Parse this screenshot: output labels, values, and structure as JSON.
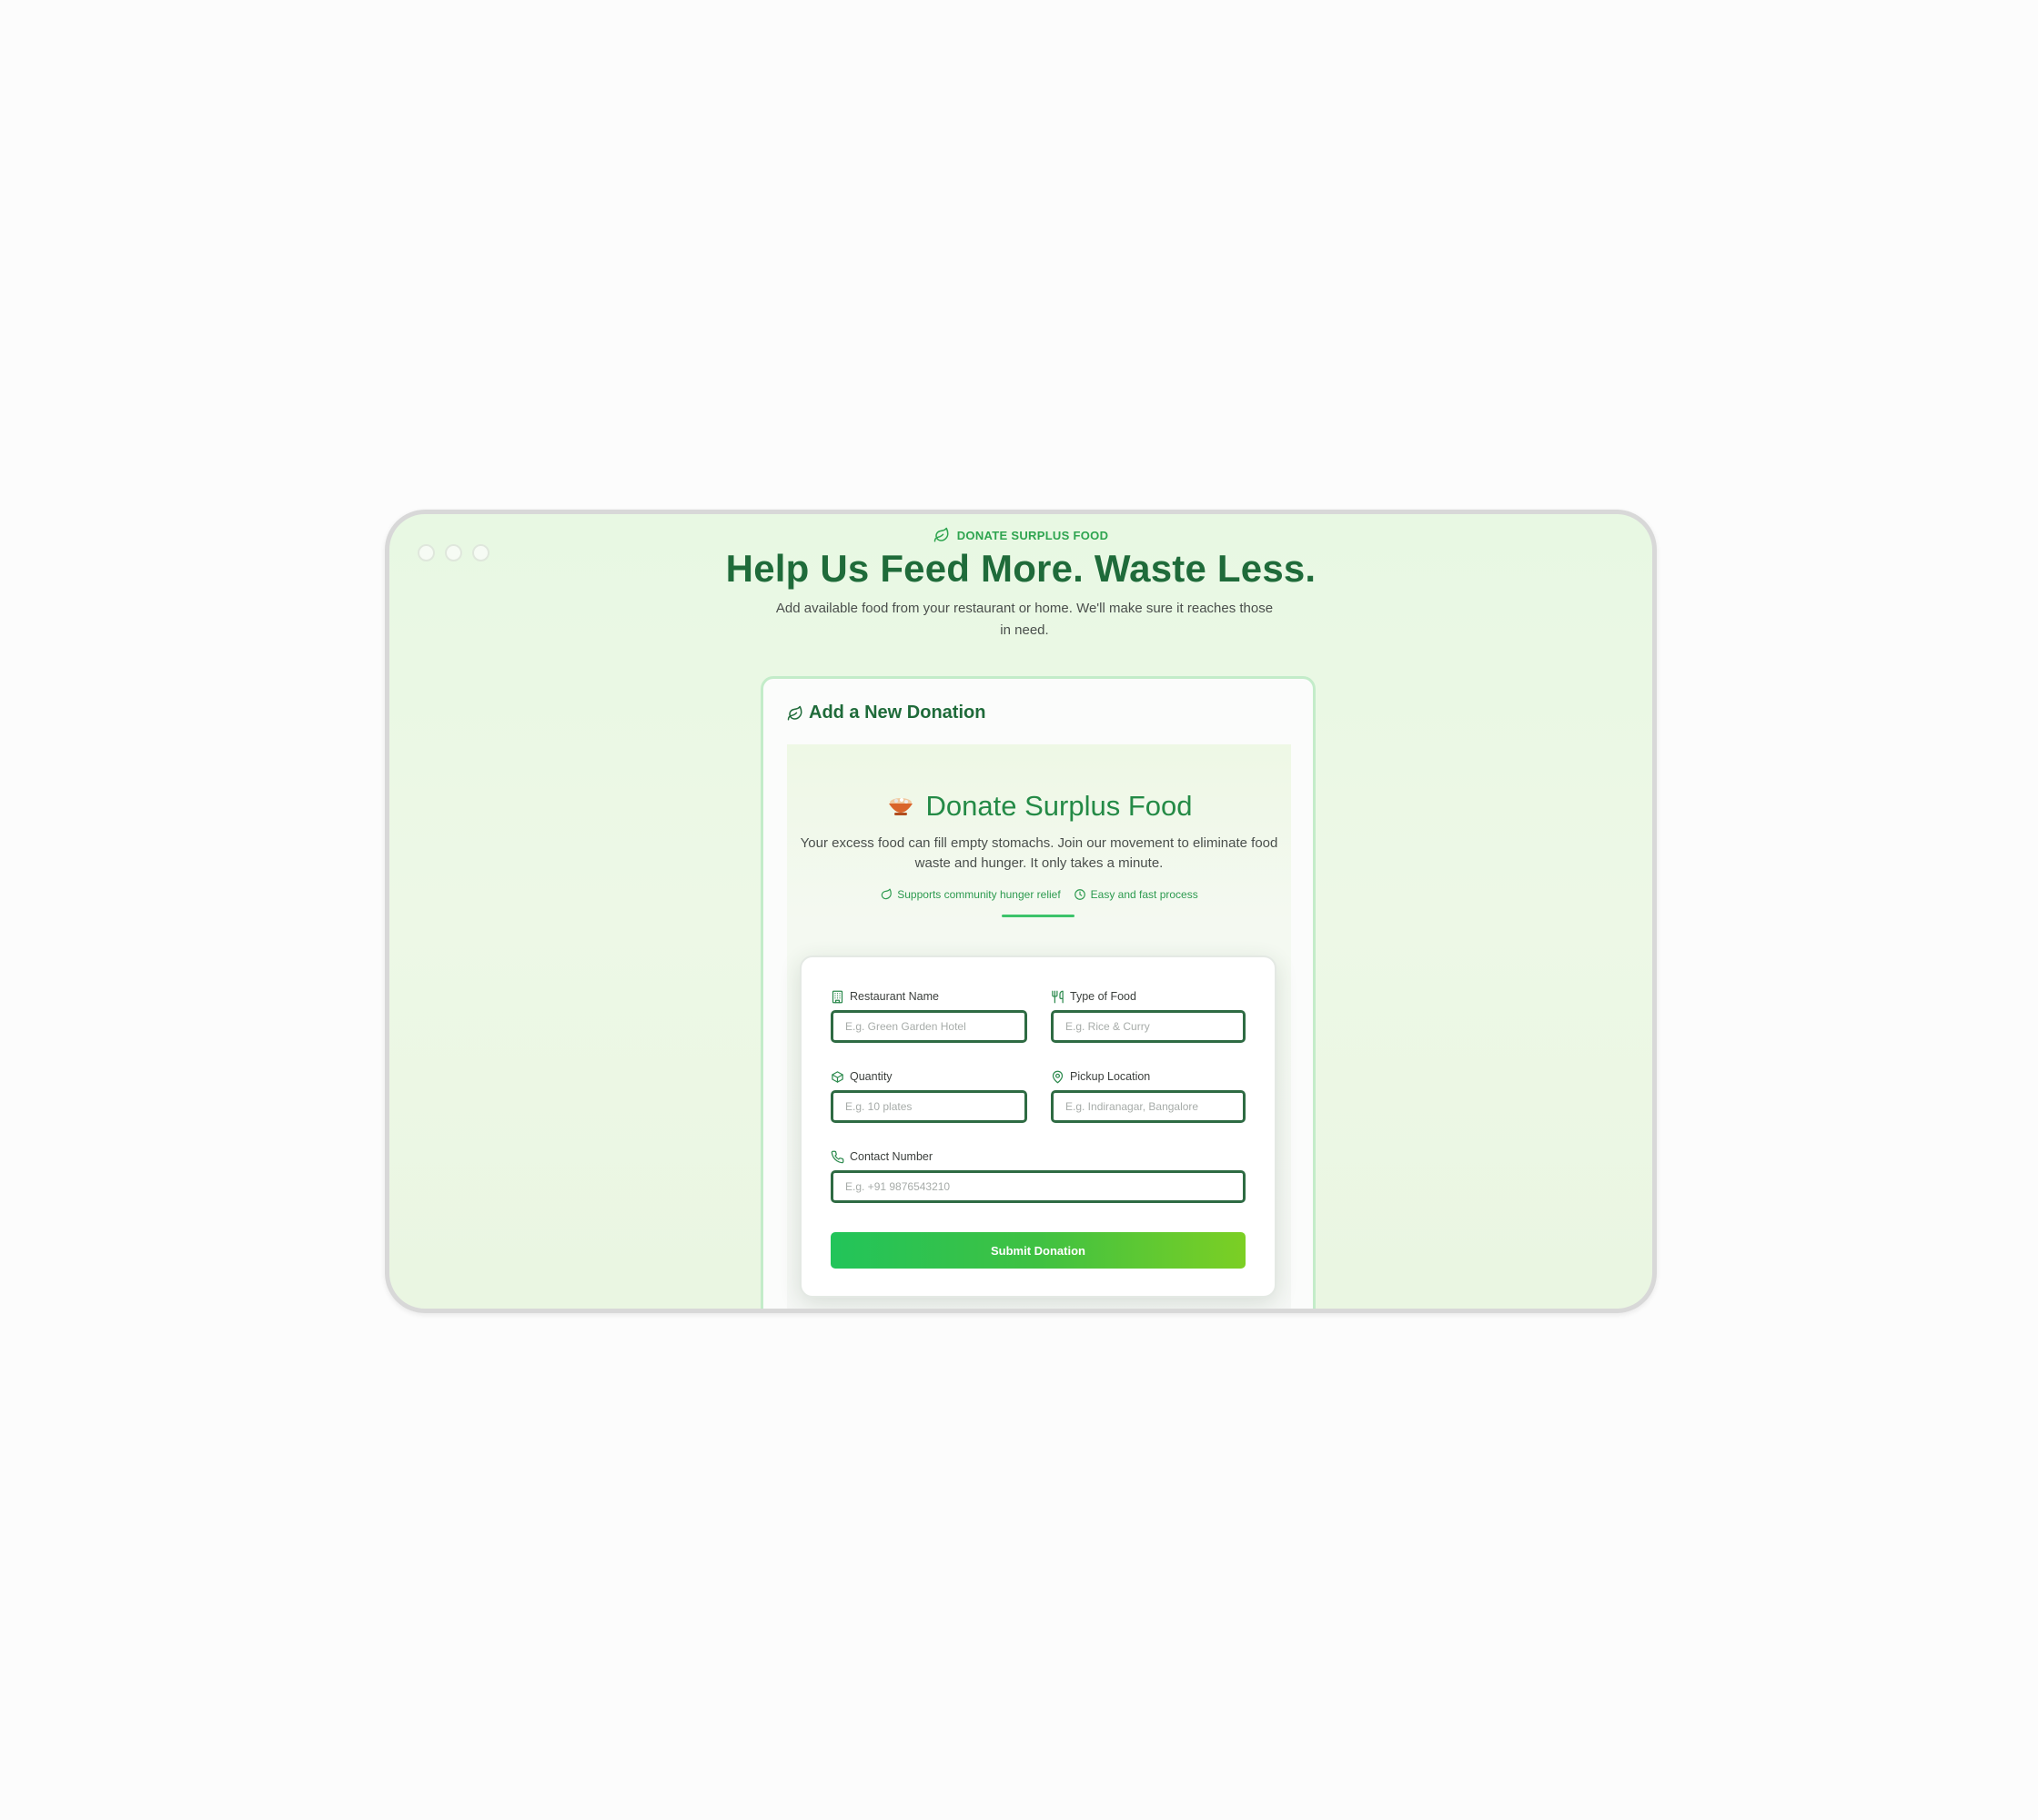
{
  "hero": {
    "eyebrow": "DONATE SURPLUS FOOD",
    "title": "Help Us Feed More. Waste Less.",
    "subtitle": "Add available food from your restaurant or home. We'll make sure it reaches those in need."
  },
  "card": {
    "header": "Add a New Donation",
    "section": {
      "title": "Donate Surplus Food",
      "description": "Your excess food can fill empty stomachs. Join our movement to eliminate food waste and hunger. It only takes a minute.",
      "badges": [
        {
          "label": "Supports community hunger relief",
          "icon": "leaf-icon"
        },
        {
          "label": "Easy and fast process",
          "icon": "clock-icon"
        }
      ]
    },
    "form": {
      "restaurant_name": {
        "label": "Restaurant Name",
        "placeholder": "E.g. Green Garden Hotel",
        "value": ""
      },
      "food_type": {
        "label": "Type of Food",
        "placeholder": "E.g. Rice & Curry",
        "value": ""
      },
      "quantity": {
        "label": "Quantity",
        "placeholder": "E.g. 10 plates",
        "value": ""
      },
      "pickup_location": {
        "label": "Pickup Location",
        "placeholder": "E.g. Indiranagar, Bangalore",
        "value": ""
      },
      "contact_number": {
        "label": "Contact Number",
        "placeholder": "E.g. +91 9876543210",
        "value": ""
      },
      "submit_label": "Submit Donation"
    }
  },
  "colors": {
    "brand_green": "#1f6b3a",
    "accent_green": "#2ea44f",
    "input_border": "#2e6b43",
    "button_gradient_start": "#22c45a",
    "button_gradient_end": "#7ccf24"
  }
}
